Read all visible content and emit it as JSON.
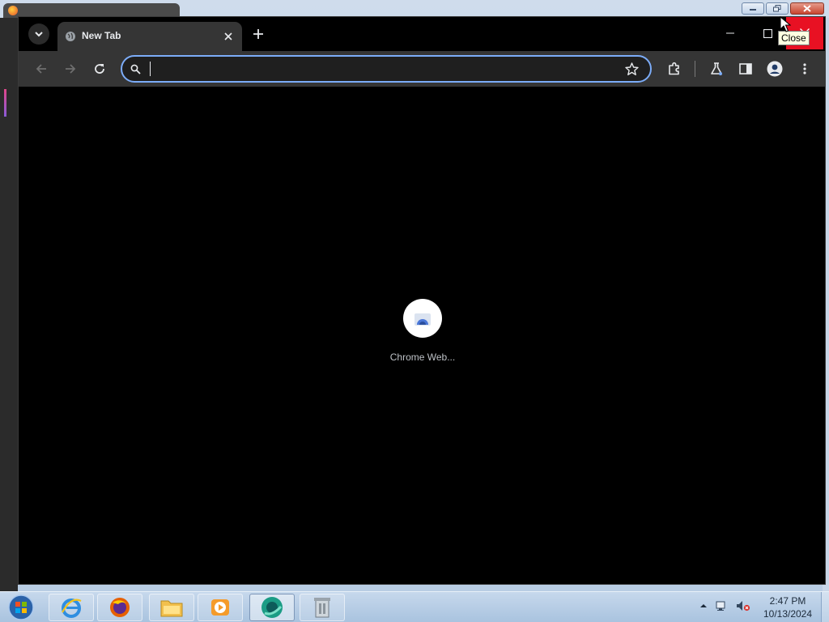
{
  "browser": {
    "tab": {
      "title": "New Tab",
      "favicon": "globe-icon"
    },
    "tooltip": "Close",
    "omnibox": {
      "value": "",
      "placeholder": ""
    },
    "accent_color": "#7cacf8"
  },
  "content": {
    "loading_app_label": "Chrome Web...",
    "loading_app_icon": "chrome-web-store-icon"
  },
  "taskbar": {
    "apps": [
      "internet-explorer-icon",
      "firefox-icon",
      "file-explorer-icon",
      "media-player-icon",
      "chrome-app-icon",
      "recycle-tool-icon"
    ],
    "clock": {
      "time": "2:47 PM",
      "date": "10/13/2024"
    }
  }
}
